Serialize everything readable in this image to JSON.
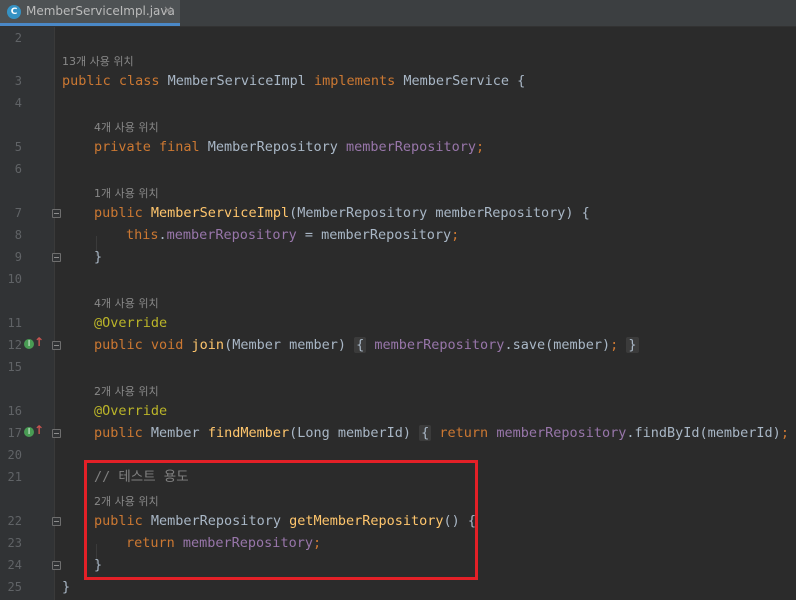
{
  "tab": {
    "icon_letter": "C",
    "filename": "MemberServiceImpl.java",
    "close": "×"
  },
  "lines": [
    {
      "num": "2"
    },
    {
      "hint": "13개 사용 위치"
    },
    {
      "num": "3"
    },
    {
      "num": "4"
    },
    {
      "hint": "4개 사용 위치"
    },
    {
      "num": "5"
    },
    {
      "num": "6"
    },
    {
      "hint": "1개 사용 위치"
    },
    {
      "num": "7"
    },
    {
      "num": "8"
    },
    {
      "num": "9"
    },
    {
      "num": "10"
    },
    {
      "hint": "4개 사용 위치"
    },
    {
      "num": "11"
    },
    {
      "num": "12"
    },
    {
      "num": "15"
    },
    {
      "hint": "2개 사용 위치"
    },
    {
      "num": "16"
    },
    {
      "num": "17"
    },
    {
      "num": "20"
    },
    {
      "num": "21"
    },
    {
      "hint": "2개 사용 위치"
    },
    {
      "num": "22"
    },
    {
      "num": "23"
    },
    {
      "num": "24"
    },
    {
      "num": "25"
    }
  ],
  "code": {
    "l3": {
      "kw1": "public class ",
      "name": "MemberServiceImpl ",
      "kw2": "implements ",
      "rest": "MemberService {"
    },
    "l5": {
      "kw": "private final ",
      "type": "MemberRepository ",
      "field": "memberRepository",
      "semi": ";"
    },
    "l7": {
      "kw": "public ",
      "method": "MemberServiceImpl",
      "rest": "(MemberRepository memberRepository) {"
    },
    "l8": {
      "kw": "this",
      "dot": ".",
      "field": "memberRepository",
      "rest": " = memberRepository",
      "semi": ";"
    },
    "l9": {
      "text": "}"
    },
    "l11": {
      "ann": "@Override"
    },
    "l12": {
      "kw": "public void ",
      "method": "join",
      "args": "(Member member) ",
      "open": "{",
      "field": "memberRepository",
      "call": ".save(member)",
      "semi": ";",
      "close": "}"
    },
    "l16": {
      "ann": "@Override"
    },
    "l17": {
      "kw": "public ",
      "type": "Member ",
      "method": "findMember",
      "args": "(Long memberId) ",
      "open": "{",
      "ret": "return ",
      "field": "memberRepository",
      "call": ".findById(memberId)",
      "semi": ";",
      "close": "}"
    },
    "l21": {
      "comment": "// 테스트 용도"
    },
    "l22": {
      "kw": "public ",
      "type": "MemberRepository ",
      "method": "getMemberRepository",
      "rest": "() {"
    },
    "l23": {
      "ret": "return ",
      "field": "memberRepository",
      "semi": ";"
    },
    "l24": {
      "text": "}"
    },
    "l25": {
      "text": "}"
    }
  },
  "gutter_icon": {
    "letter": "I",
    "arrow": "↑"
  },
  "colors": {
    "background": "#2b2b2b",
    "keyword": "#cc7832",
    "field": "#9876aa",
    "method": "#ffc66d",
    "annotation": "#bbb529",
    "highlight": "#e32027"
  }
}
